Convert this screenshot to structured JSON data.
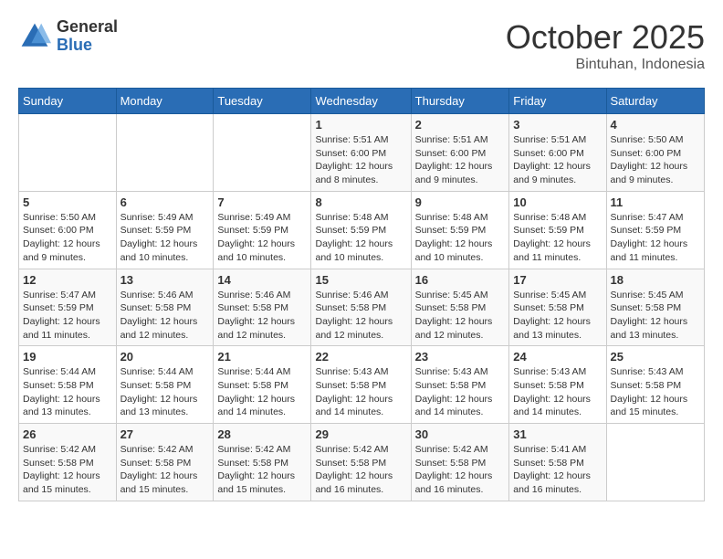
{
  "header": {
    "logo_general": "General",
    "logo_blue": "Blue",
    "month": "October 2025",
    "location": "Bintuhan, Indonesia"
  },
  "days_of_week": [
    "Sunday",
    "Monday",
    "Tuesday",
    "Wednesday",
    "Thursday",
    "Friday",
    "Saturday"
  ],
  "weeks": [
    [
      {
        "day": "",
        "info": ""
      },
      {
        "day": "",
        "info": ""
      },
      {
        "day": "",
        "info": ""
      },
      {
        "day": "1",
        "info": "Sunrise: 5:51 AM\nSunset: 6:00 PM\nDaylight: 12 hours and 8 minutes."
      },
      {
        "day": "2",
        "info": "Sunrise: 5:51 AM\nSunset: 6:00 PM\nDaylight: 12 hours and 9 minutes."
      },
      {
        "day": "3",
        "info": "Sunrise: 5:51 AM\nSunset: 6:00 PM\nDaylight: 12 hours and 9 minutes."
      },
      {
        "day": "4",
        "info": "Sunrise: 5:50 AM\nSunset: 6:00 PM\nDaylight: 12 hours and 9 minutes."
      }
    ],
    [
      {
        "day": "5",
        "info": "Sunrise: 5:50 AM\nSunset: 6:00 PM\nDaylight: 12 hours and 9 minutes."
      },
      {
        "day": "6",
        "info": "Sunrise: 5:49 AM\nSunset: 5:59 PM\nDaylight: 12 hours and 10 minutes."
      },
      {
        "day": "7",
        "info": "Sunrise: 5:49 AM\nSunset: 5:59 PM\nDaylight: 12 hours and 10 minutes."
      },
      {
        "day": "8",
        "info": "Sunrise: 5:48 AM\nSunset: 5:59 PM\nDaylight: 12 hours and 10 minutes."
      },
      {
        "day": "9",
        "info": "Sunrise: 5:48 AM\nSunset: 5:59 PM\nDaylight: 12 hours and 10 minutes."
      },
      {
        "day": "10",
        "info": "Sunrise: 5:48 AM\nSunset: 5:59 PM\nDaylight: 12 hours and 11 minutes."
      },
      {
        "day": "11",
        "info": "Sunrise: 5:47 AM\nSunset: 5:59 PM\nDaylight: 12 hours and 11 minutes."
      }
    ],
    [
      {
        "day": "12",
        "info": "Sunrise: 5:47 AM\nSunset: 5:59 PM\nDaylight: 12 hours and 11 minutes."
      },
      {
        "day": "13",
        "info": "Sunrise: 5:46 AM\nSunset: 5:58 PM\nDaylight: 12 hours and 12 minutes."
      },
      {
        "day": "14",
        "info": "Sunrise: 5:46 AM\nSunset: 5:58 PM\nDaylight: 12 hours and 12 minutes."
      },
      {
        "day": "15",
        "info": "Sunrise: 5:46 AM\nSunset: 5:58 PM\nDaylight: 12 hours and 12 minutes."
      },
      {
        "day": "16",
        "info": "Sunrise: 5:45 AM\nSunset: 5:58 PM\nDaylight: 12 hours and 12 minutes."
      },
      {
        "day": "17",
        "info": "Sunrise: 5:45 AM\nSunset: 5:58 PM\nDaylight: 12 hours and 13 minutes."
      },
      {
        "day": "18",
        "info": "Sunrise: 5:45 AM\nSunset: 5:58 PM\nDaylight: 12 hours and 13 minutes."
      }
    ],
    [
      {
        "day": "19",
        "info": "Sunrise: 5:44 AM\nSunset: 5:58 PM\nDaylight: 12 hours and 13 minutes."
      },
      {
        "day": "20",
        "info": "Sunrise: 5:44 AM\nSunset: 5:58 PM\nDaylight: 12 hours and 13 minutes."
      },
      {
        "day": "21",
        "info": "Sunrise: 5:44 AM\nSunset: 5:58 PM\nDaylight: 12 hours and 14 minutes."
      },
      {
        "day": "22",
        "info": "Sunrise: 5:43 AM\nSunset: 5:58 PM\nDaylight: 12 hours and 14 minutes."
      },
      {
        "day": "23",
        "info": "Sunrise: 5:43 AM\nSunset: 5:58 PM\nDaylight: 12 hours and 14 minutes."
      },
      {
        "day": "24",
        "info": "Sunrise: 5:43 AM\nSunset: 5:58 PM\nDaylight: 12 hours and 14 minutes."
      },
      {
        "day": "25",
        "info": "Sunrise: 5:43 AM\nSunset: 5:58 PM\nDaylight: 12 hours and 15 minutes."
      }
    ],
    [
      {
        "day": "26",
        "info": "Sunrise: 5:42 AM\nSunset: 5:58 PM\nDaylight: 12 hours and 15 minutes."
      },
      {
        "day": "27",
        "info": "Sunrise: 5:42 AM\nSunset: 5:58 PM\nDaylight: 12 hours and 15 minutes."
      },
      {
        "day": "28",
        "info": "Sunrise: 5:42 AM\nSunset: 5:58 PM\nDaylight: 12 hours and 15 minutes."
      },
      {
        "day": "29",
        "info": "Sunrise: 5:42 AM\nSunset: 5:58 PM\nDaylight: 12 hours and 16 minutes."
      },
      {
        "day": "30",
        "info": "Sunrise: 5:42 AM\nSunset: 5:58 PM\nDaylight: 12 hours and 16 minutes."
      },
      {
        "day": "31",
        "info": "Sunrise: 5:41 AM\nSunset: 5:58 PM\nDaylight: 12 hours and 16 minutes."
      },
      {
        "day": "",
        "info": ""
      }
    ]
  ]
}
